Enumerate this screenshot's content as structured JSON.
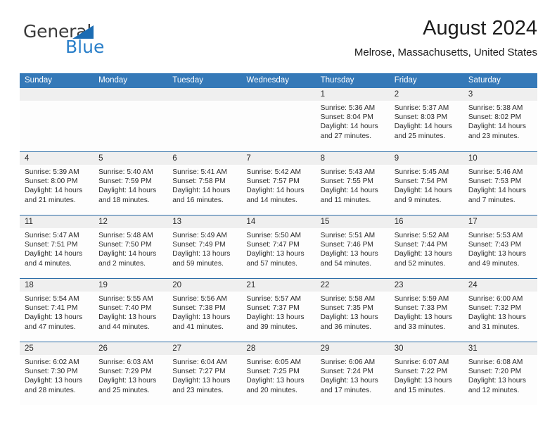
{
  "brand": {
    "word_one": "General",
    "word_two": "Blue",
    "logo_icon": "blue-triangle-icon",
    "accent_color": "#2a7fc9"
  },
  "header": {
    "title": "August 2024",
    "subtitle": "Melrose, Massachusetts, United States"
  },
  "calendar": {
    "header_color": "#3579b8",
    "day_strip_color": "#efefef",
    "row_divider_color": "#2c6ca6",
    "day_names": [
      "Sunday",
      "Monday",
      "Tuesday",
      "Wednesday",
      "Thursday",
      "Friday",
      "Saturday"
    ],
    "weeks": [
      [
        {
          "date": "",
          "empty": true
        },
        {
          "date": "",
          "empty": true
        },
        {
          "date": "",
          "empty": true
        },
        {
          "date": "",
          "empty": true
        },
        {
          "date": "1",
          "sunrise": "Sunrise: 5:36 AM",
          "sunset": "Sunset: 8:04 PM",
          "daylight_1": "Daylight: 14 hours",
          "daylight_2": "and 27 minutes."
        },
        {
          "date": "2",
          "sunrise": "Sunrise: 5:37 AM",
          "sunset": "Sunset: 8:03 PM",
          "daylight_1": "Daylight: 14 hours",
          "daylight_2": "and 25 minutes."
        },
        {
          "date": "3",
          "sunrise": "Sunrise: 5:38 AM",
          "sunset": "Sunset: 8:02 PM",
          "daylight_1": "Daylight: 14 hours",
          "daylight_2": "and 23 minutes."
        }
      ],
      [
        {
          "date": "4",
          "sunrise": "Sunrise: 5:39 AM",
          "sunset": "Sunset: 8:00 PM",
          "daylight_1": "Daylight: 14 hours",
          "daylight_2": "and 21 minutes."
        },
        {
          "date": "5",
          "sunrise": "Sunrise: 5:40 AM",
          "sunset": "Sunset: 7:59 PM",
          "daylight_1": "Daylight: 14 hours",
          "daylight_2": "and 18 minutes."
        },
        {
          "date": "6",
          "sunrise": "Sunrise: 5:41 AM",
          "sunset": "Sunset: 7:58 PM",
          "daylight_1": "Daylight: 14 hours",
          "daylight_2": "and 16 minutes."
        },
        {
          "date": "7",
          "sunrise": "Sunrise: 5:42 AM",
          "sunset": "Sunset: 7:57 PM",
          "daylight_1": "Daylight: 14 hours",
          "daylight_2": "and 14 minutes."
        },
        {
          "date": "8",
          "sunrise": "Sunrise: 5:43 AM",
          "sunset": "Sunset: 7:55 PM",
          "daylight_1": "Daylight: 14 hours",
          "daylight_2": "and 11 minutes."
        },
        {
          "date": "9",
          "sunrise": "Sunrise: 5:45 AM",
          "sunset": "Sunset: 7:54 PM",
          "daylight_1": "Daylight: 14 hours",
          "daylight_2": "and 9 minutes."
        },
        {
          "date": "10",
          "sunrise": "Sunrise: 5:46 AM",
          "sunset": "Sunset: 7:53 PM",
          "daylight_1": "Daylight: 14 hours",
          "daylight_2": "and 7 minutes."
        }
      ],
      [
        {
          "date": "11",
          "sunrise": "Sunrise: 5:47 AM",
          "sunset": "Sunset: 7:51 PM",
          "daylight_1": "Daylight: 14 hours",
          "daylight_2": "and 4 minutes."
        },
        {
          "date": "12",
          "sunrise": "Sunrise: 5:48 AM",
          "sunset": "Sunset: 7:50 PM",
          "daylight_1": "Daylight: 14 hours",
          "daylight_2": "and 2 minutes."
        },
        {
          "date": "13",
          "sunrise": "Sunrise: 5:49 AM",
          "sunset": "Sunset: 7:49 PM",
          "daylight_1": "Daylight: 13 hours",
          "daylight_2": "and 59 minutes."
        },
        {
          "date": "14",
          "sunrise": "Sunrise: 5:50 AM",
          "sunset": "Sunset: 7:47 PM",
          "daylight_1": "Daylight: 13 hours",
          "daylight_2": "and 57 minutes."
        },
        {
          "date": "15",
          "sunrise": "Sunrise: 5:51 AM",
          "sunset": "Sunset: 7:46 PM",
          "daylight_1": "Daylight: 13 hours",
          "daylight_2": "and 54 minutes."
        },
        {
          "date": "16",
          "sunrise": "Sunrise: 5:52 AM",
          "sunset": "Sunset: 7:44 PM",
          "daylight_1": "Daylight: 13 hours",
          "daylight_2": "and 52 minutes."
        },
        {
          "date": "17",
          "sunrise": "Sunrise: 5:53 AM",
          "sunset": "Sunset: 7:43 PM",
          "daylight_1": "Daylight: 13 hours",
          "daylight_2": "and 49 minutes."
        }
      ],
      [
        {
          "date": "18",
          "sunrise": "Sunrise: 5:54 AM",
          "sunset": "Sunset: 7:41 PM",
          "daylight_1": "Daylight: 13 hours",
          "daylight_2": "and 47 minutes."
        },
        {
          "date": "19",
          "sunrise": "Sunrise: 5:55 AM",
          "sunset": "Sunset: 7:40 PM",
          "daylight_1": "Daylight: 13 hours",
          "daylight_2": "and 44 minutes."
        },
        {
          "date": "20",
          "sunrise": "Sunrise: 5:56 AM",
          "sunset": "Sunset: 7:38 PM",
          "daylight_1": "Daylight: 13 hours",
          "daylight_2": "and 41 minutes."
        },
        {
          "date": "21",
          "sunrise": "Sunrise: 5:57 AM",
          "sunset": "Sunset: 7:37 PM",
          "daylight_1": "Daylight: 13 hours",
          "daylight_2": "and 39 minutes."
        },
        {
          "date": "22",
          "sunrise": "Sunrise: 5:58 AM",
          "sunset": "Sunset: 7:35 PM",
          "daylight_1": "Daylight: 13 hours",
          "daylight_2": "and 36 minutes."
        },
        {
          "date": "23",
          "sunrise": "Sunrise: 5:59 AM",
          "sunset": "Sunset: 7:33 PM",
          "daylight_1": "Daylight: 13 hours",
          "daylight_2": "and 33 minutes."
        },
        {
          "date": "24",
          "sunrise": "Sunrise: 6:00 AM",
          "sunset": "Sunset: 7:32 PM",
          "daylight_1": "Daylight: 13 hours",
          "daylight_2": "and 31 minutes."
        }
      ],
      [
        {
          "date": "25",
          "sunrise": "Sunrise: 6:02 AM",
          "sunset": "Sunset: 7:30 PM",
          "daylight_1": "Daylight: 13 hours",
          "daylight_2": "and 28 minutes."
        },
        {
          "date": "26",
          "sunrise": "Sunrise: 6:03 AM",
          "sunset": "Sunset: 7:29 PM",
          "daylight_1": "Daylight: 13 hours",
          "daylight_2": "and 25 minutes."
        },
        {
          "date": "27",
          "sunrise": "Sunrise: 6:04 AM",
          "sunset": "Sunset: 7:27 PM",
          "daylight_1": "Daylight: 13 hours",
          "daylight_2": "and 23 minutes."
        },
        {
          "date": "28",
          "sunrise": "Sunrise: 6:05 AM",
          "sunset": "Sunset: 7:25 PM",
          "daylight_1": "Daylight: 13 hours",
          "daylight_2": "and 20 minutes."
        },
        {
          "date": "29",
          "sunrise": "Sunrise: 6:06 AM",
          "sunset": "Sunset: 7:24 PM",
          "daylight_1": "Daylight: 13 hours",
          "daylight_2": "and 17 minutes."
        },
        {
          "date": "30",
          "sunrise": "Sunrise: 6:07 AM",
          "sunset": "Sunset: 7:22 PM",
          "daylight_1": "Daylight: 13 hours",
          "daylight_2": "and 15 minutes."
        },
        {
          "date": "31",
          "sunrise": "Sunrise: 6:08 AM",
          "sunset": "Sunset: 7:20 PM",
          "daylight_1": "Daylight: 13 hours",
          "daylight_2": "and 12 minutes."
        }
      ]
    ]
  }
}
